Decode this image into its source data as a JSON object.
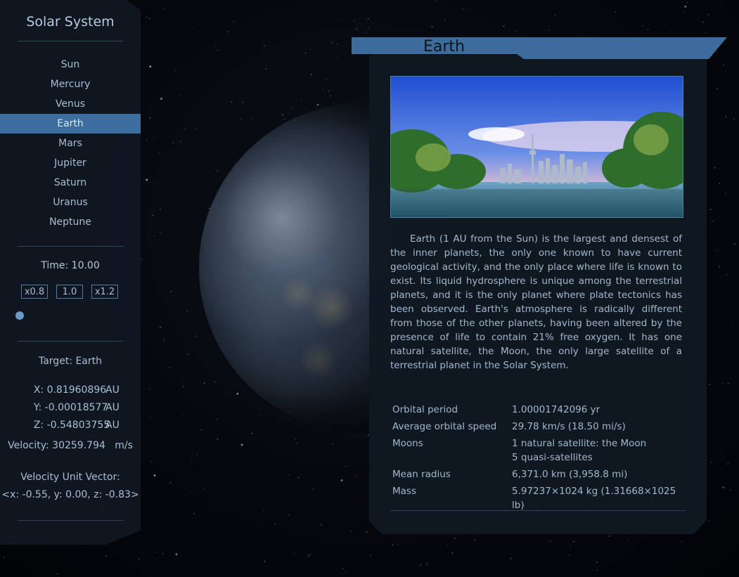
{
  "sidebar": {
    "title": "Solar System",
    "planets": [
      {
        "label": "Sun"
      },
      {
        "label": "Mercury"
      },
      {
        "label": "Venus"
      },
      {
        "label": "Earth",
        "active": true
      },
      {
        "label": "Mars"
      },
      {
        "label": "Jupiter"
      },
      {
        "label": "Saturn"
      },
      {
        "label": "Uranus"
      },
      {
        "label": "Neptune"
      }
    ],
    "time_text": "Time: 10.00",
    "speed_buttons": {
      "slower": "x0.8",
      "reset": "1.0",
      "faster": "x1.2"
    },
    "target_text": "Target: Earth",
    "x_text": "X: 0.81960896",
    "y_text": "Y: -0.00018577",
    "z_text": "Z: -0.54803755",
    "coord_unit": "AU",
    "velocity_text": "Velocity: 30259.794   m/s",
    "velocity_vector_label": "Velocity Unit Vector:",
    "velocity_vector_value": "<x: -0.55, y: 0.00, z: -0.83>"
  },
  "panel": {
    "title": "Earth",
    "description": "Earth (1 AU from the Sun) is the largest and densest of the inner planets, the only one known to have current geological activity, and the only place where life is known to exist. Its liquid hydrosphere is unique among the terrestrial planets, and it is the only planet where plate tectonics has been observed. Earth's atmosphere is radically different from those of the other planets, having been altered by the presence of life to contain 21% free oxygen. It has one natural satellite, the Moon, the only large satellite of a terrestrial planet in the Solar System.",
    "facts": [
      {
        "key": "Orbital period",
        "value": "1.00001742096 yr"
      },
      {
        "key": "Average orbital speed",
        "value": "29.78 km/s (18.50 mi/s)"
      },
      {
        "key": "Moons",
        "value": "1 natural satellite: the Moon",
        "value2": "5 quasi-satellites"
      },
      {
        "key": "Mean radius",
        "value": "6,371.0 km (3,958.8 mi)"
      },
      {
        "key": "Mass",
        "value": "5.97237×1024 kg (1.31668×1025 lb)"
      }
    ]
  },
  "colors": {
    "accent": "#3d6d9e",
    "panel_bg": "#101822",
    "text": "#a9bfd6"
  }
}
